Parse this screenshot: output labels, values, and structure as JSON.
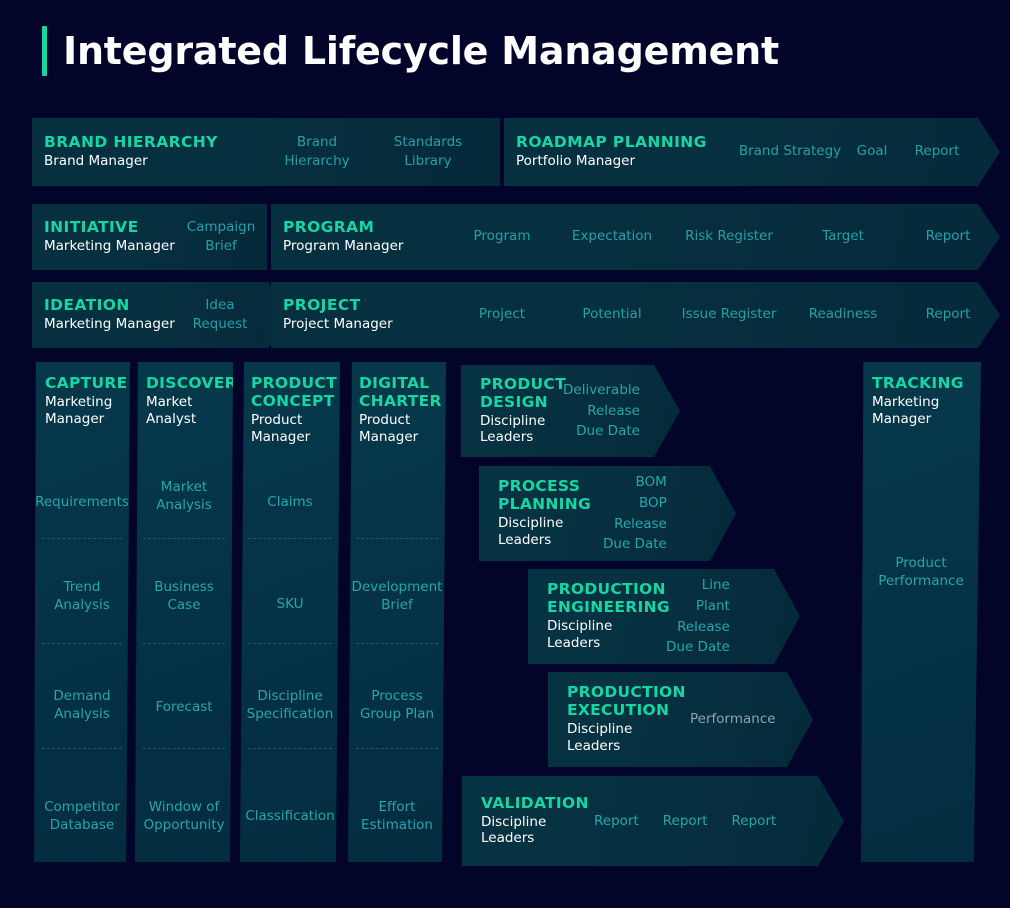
{
  "header": {
    "title": "Integrated Lifecycle Management"
  },
  "rows": [
    {
      "banners": [
        {
          "name": "brand-hierarchy",
          "title": "BRAND HIERARCHY",
          "role": "Brand Manager",
          "tags": [
            "Brand\nHierarchy",
            "Standards\nLibrary"
          ]
        },
        {
          "name": "roadmap-planning",
          "title": "ROADMAP PLANNING",
          "role": "Portfolio Manager",
          "tags": [
            "Brand Strategy",
            "Goal",
            "Report"
          ]
        }
      ]
    },
    {
      "banners": [
        {
          "name": "initiative",
          "title": "INITIATIVE",
          "role": "Marketing Manager",
          "tags": [
            "Campaign\nBrief"
          ]
        },
        {
          "name": "program",
          "title": "PROGRAM",
          "role": "Program Manager",
          "tags": [
            "Program",
            "Expectation",
            "Risk Register",
            "Target",
            "Report"
          ]
        }
      ]
    },
    {
      "banners": [
        {
          "name": "ideation",
          "title": "IDEATION",
          "role": "Marketing Manager",
          "tags": [
            "Idea\nRequest"
          ]
        },
        {
          "name": "project",
          "title": "PROJECT",
          "role": "Project Manager",
          "tags": [
            "Project",
            "Potential",
            "Issue Register",
            "Readiness",
            "Report"
          ]
        }
      ]
    }
  ],
  "columns": [
    {
      "name": "capture",
      "title": "CAPTURE",
      "role": "Marketing\nManager",
      "items": [
        "Requirements",
        "Trend\nAnalysis",
        "Demand\nAnalysis",
        "Competitor\nDatabase"
      ]
    },
    {
      "name": "discover",
      "title": "DISCOVER",
      "role": "Market\nAnalyst",
      "items": [
        "Market\nAnalysis",
        "Business\nCase",
        "Forecast",
        "Window of\nOpportunity"
      ]
    },
    {
      "name": "product-concept",
      "title": "PRODUCT\nCONCEPT",
      "role": "Product\nManager",
      "items": [
        "Claims",
        "SKU",
        "Discipline\nSpecification",
        "Classification"
      ]
    },
    {
      "name": "digital-charter",
      "title": "DIGITAL\nCHARTER",
      "role": "Product\nManager",
      "items": [
        "",
        "Development\nBrief",
        "Process\nGroup Plan",
        "Effort\nEstimation"
      ]
    }
  ],
  "tracking": {
    "name": "tracking",
    "title": "TRACKING",
    "role": "Marketing\nManager",
    "item": "Product\nPerformance"
  },
  "stages": [
    {
      "name": "product-design",
      "title": "PRODUCT\nDESIGN",
      "role": "Discipline\nLeaders",
      "tags": [
        "Deliverable",
        "Release",
        "Due Date"
      ],
      "layout": "stagger"
    },
    {
      "name": "process-planning",
      "title": "PROCESS\nPLANNING",
      "role": "Discipline\nLeaders",
      "tags": [
        "BOM",
        "BOP",
        "Release",
        "Due Date"
      ],
      "layout": "stagger"
    },
    {
      "name": "production-engineering",
      "title": "PRODUCTION\nENGINEERING",
      "role": "Discipline\nLeaders",
      "tags": [
        "Line",
        "Plant",
        "Release",
        "Due Date"
      ],
      "layout": "stagger"
    },
    {
      "name": "production-execution",
      "title": "PRODUCTION\nEXECUTION",
      "role": "Discipline\nLeaders",
      "tags": [
        "Performance"
      ],
      "layout": "single-muted"
    },
    {
      "name": "validation",
      "title": "VALIDATION",
      "role": "Discipline\nLeaders",
      "tags": [
        "Report",
        "Report",
        "Report"
      ],
      "layout": "row"
    }
  ],
  "colors": {
    "background": "#03042a",
    "accent": "#16d6a4",
    "tag_text": "#27a6ad",
    "role_text": "#ffffff",
    "panel_fill": "#063343"
  }
}
